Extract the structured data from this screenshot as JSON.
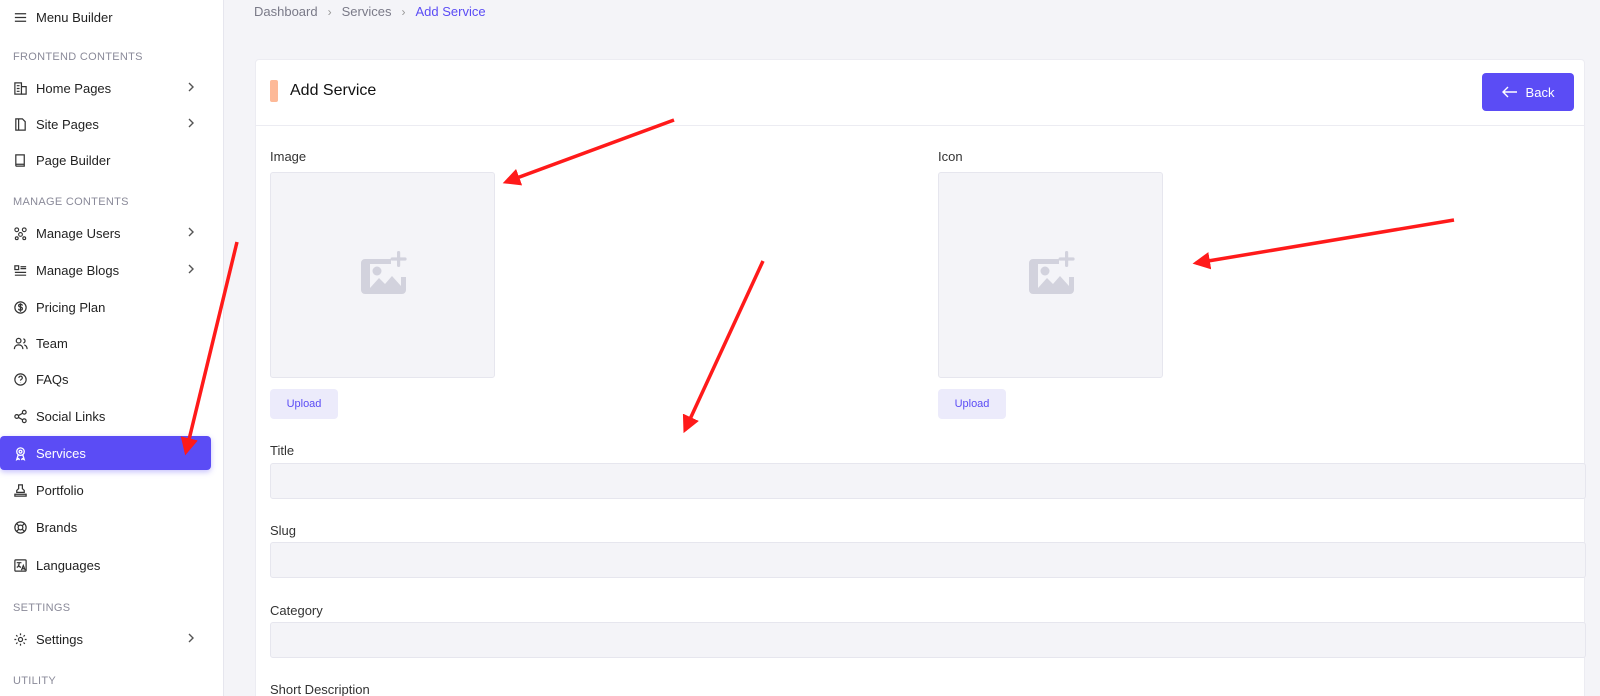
{
  "sidebar": {
    "top_item": "Menu Builder",
    "sections": {
      "frontend": "FRONTEND CONTENTS",
      "manage": "MANAGE CONTENTS",
      "settings": "SETTINGS",
      "utility": "UTILITY"
    },
    "items": {
      "home_pages": "Home Pages",
      "site_pages": "Site Pages",
      "page_builder": "Page Builder",
      "manage_users": "Manage Users",
      "manage_blogs": "Manage Blogs",
      "pricing_plan": "Pricing Plan",
      "team": "Team",
      "faqs": "FAQs",
      "social_links": "Social Links",
      "services": "Services",
      "portfolio": "Portfolio",
      "brands": "Brands",
      "languages": "Languages",
      "settings": "Settings"
    },
    "active_color": "#5b4cf5"
  },
  "breadcrumb": {
    "dashboard": "Dashboard",
    "services": "Services",
    "current": "Add Service"
  },
  "card": {
    "title": "Add Service",
    "back_label": "Back",
    "image_label": "Image",
    "icon_label": "Icon",
    "upload_label": "Upload",
    "title_label": "Title",
    "slug_label": "Slug",
    "category_label": "Category",
    "short_description_label": "Short Description"
  },
  "annotation_color": "#ff1a1a"
}
